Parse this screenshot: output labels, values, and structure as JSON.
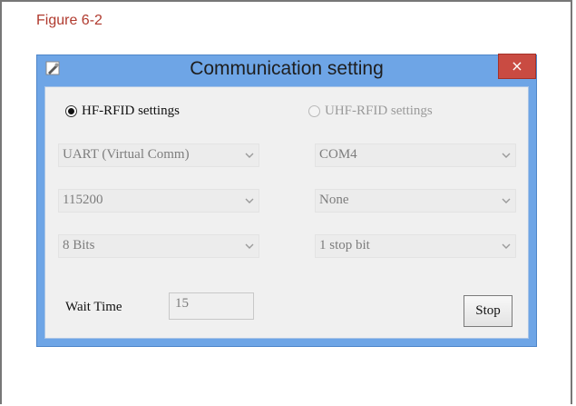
{
  "figure_caption": "Figure 6-2",
  "window": {
    "title": "Communication setting",
    "close_glyph": "×"
  },
  "radio": {
    "hf_label": "HF-RFID settings",
    "uhf_label": "UHF-RFID settings"
  },
  "combos": {
    "interface": "UART (Virtual Comm)",
    "port": "COM4",
    "baud": "115200",
    "parity": "None",
    "data_bits": "8 Bits",
    "stop_bits": "1 stop bit"
  },
  "wait": {
    "label": "Wait Time",
    "value": "15"
  },
  "stop_button": "Stop"
}
